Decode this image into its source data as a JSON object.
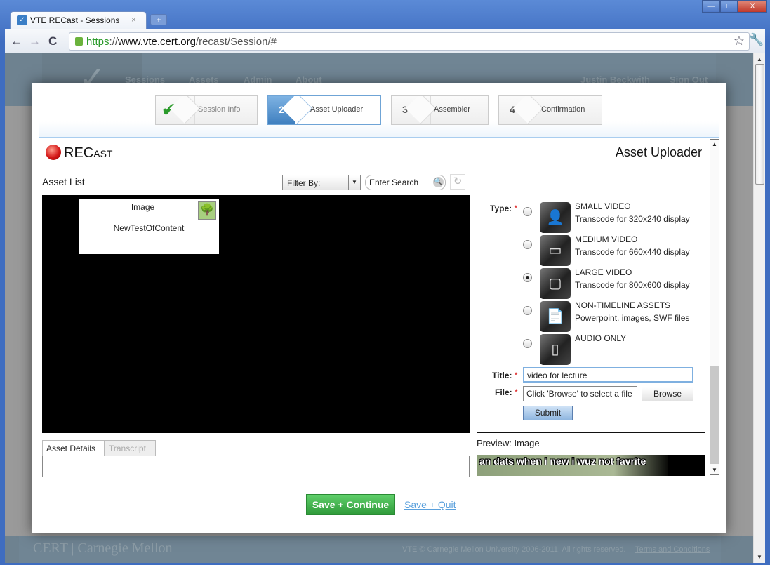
{
  "browser": {
    "tab_title": "VTE RECast - Sessions",
    "tab_close": "×",
    "new_tab": "+",
    "url_scheme": "https",
    "url_sep": "://",
    "url_host": "www.vte.cert.org",
    "url_path": "/recast/Session/#",
    "window_controls": {
      "minimize": "—",
      "maximize": "□",
      "close": "X"
    },
    "nav": {
      "back": "←",
      "forward": "→",
      "reload": "C",
      "star": "☆",
      "wrench": "🔧"
    }
  },
  "site": {
    "nav": [
      "Sessions",
      "Assets",
      "Admin",
      "About"
    ],
    "user": "Justin Beckwith",
    "sign_out": "Sign Out",
    "footer": {
      "logo_text": "CERT | Carnegie Mellon",
      "copyright": "VTE © Carnegie Mellon University 2006-2011. All rights reserved.",
      "terms": "Terms and Conditions"
    }
  },
  "wizard": {
    "steps": [
      {
        "num": "✔",
        "label": "Session Info",
        "state": "done"
      },
      {
        "num": "2",
        "label": "Asset Uploader",
        "state": "active"
      },
      {
        "num": "3",
        "label": "Assembler",
        "state": "pending"
      },
      {
        "num": "4",
        "label": "Confirmation",
        "state": "pending"
      }
    ]
  },
  "app": {
    "logo_big": "REC",
    "logo_small": "AST",
    "page_title": "Asset Uploader"
  },
  "asset_list": {
    "title": "Asset List",
    "filter_label": "Filter By:",
    "search_placeholder": "Enter Search",
    "items": [
      {
        "type": "Image",
        "name": "NewTestOfContent"
      }
    ]
  },
  "detail_tabs": [
    {
      "label": "Asset Details",
      "active": true
    },
    {
      "label": "Transcript",
      "active": false
    }
  ],
  "uploader": {
    "type_label": "Type:",
    "title_label": "Title:",
    "file_label": "File:",
    "required": "*",
    "options": [
      {
        "name": "SMALL VIDEO",
        "desc": "Transcode for 320x240 display",
        "selected": false,
        "icon": "👤"
      },
      {
        "name": "MEDIUM VIDEO",
        "desc": "Transcode for 660x440 display",
        "selected": false,
        "icon": "▭"
      },
      {
        "name": "LARGE VIDEO",
        "desc": "Transcode for 800x600 display",
        "selected": true,
        "icon": "▢"
      },
      {
        "name": "NON-TIMELINE ASSETS",
        "desc": "Powerpoint, images, SWF files",
        "selected": false,
        "icon": "📄"
      },
      {
        "name": "AUDIO ONLY",
        "desc": "",
        "selected": false,
        "icon": "▯"
      }
    ],
    "title_value": "video for lecture",
    "file_value": "Click 'Browse' to select a file",
    "browse_label": "Browse",
    "submit_label": "Submit"
  },
  "preview": {
    "label": "Preview: Image",
    "caption": "an dats when i new i wuz not favrite"
  },
  "actions": {
    "save_continue": "Save + Continue",
    "save_quit": "Save + Quit"
  }
}
